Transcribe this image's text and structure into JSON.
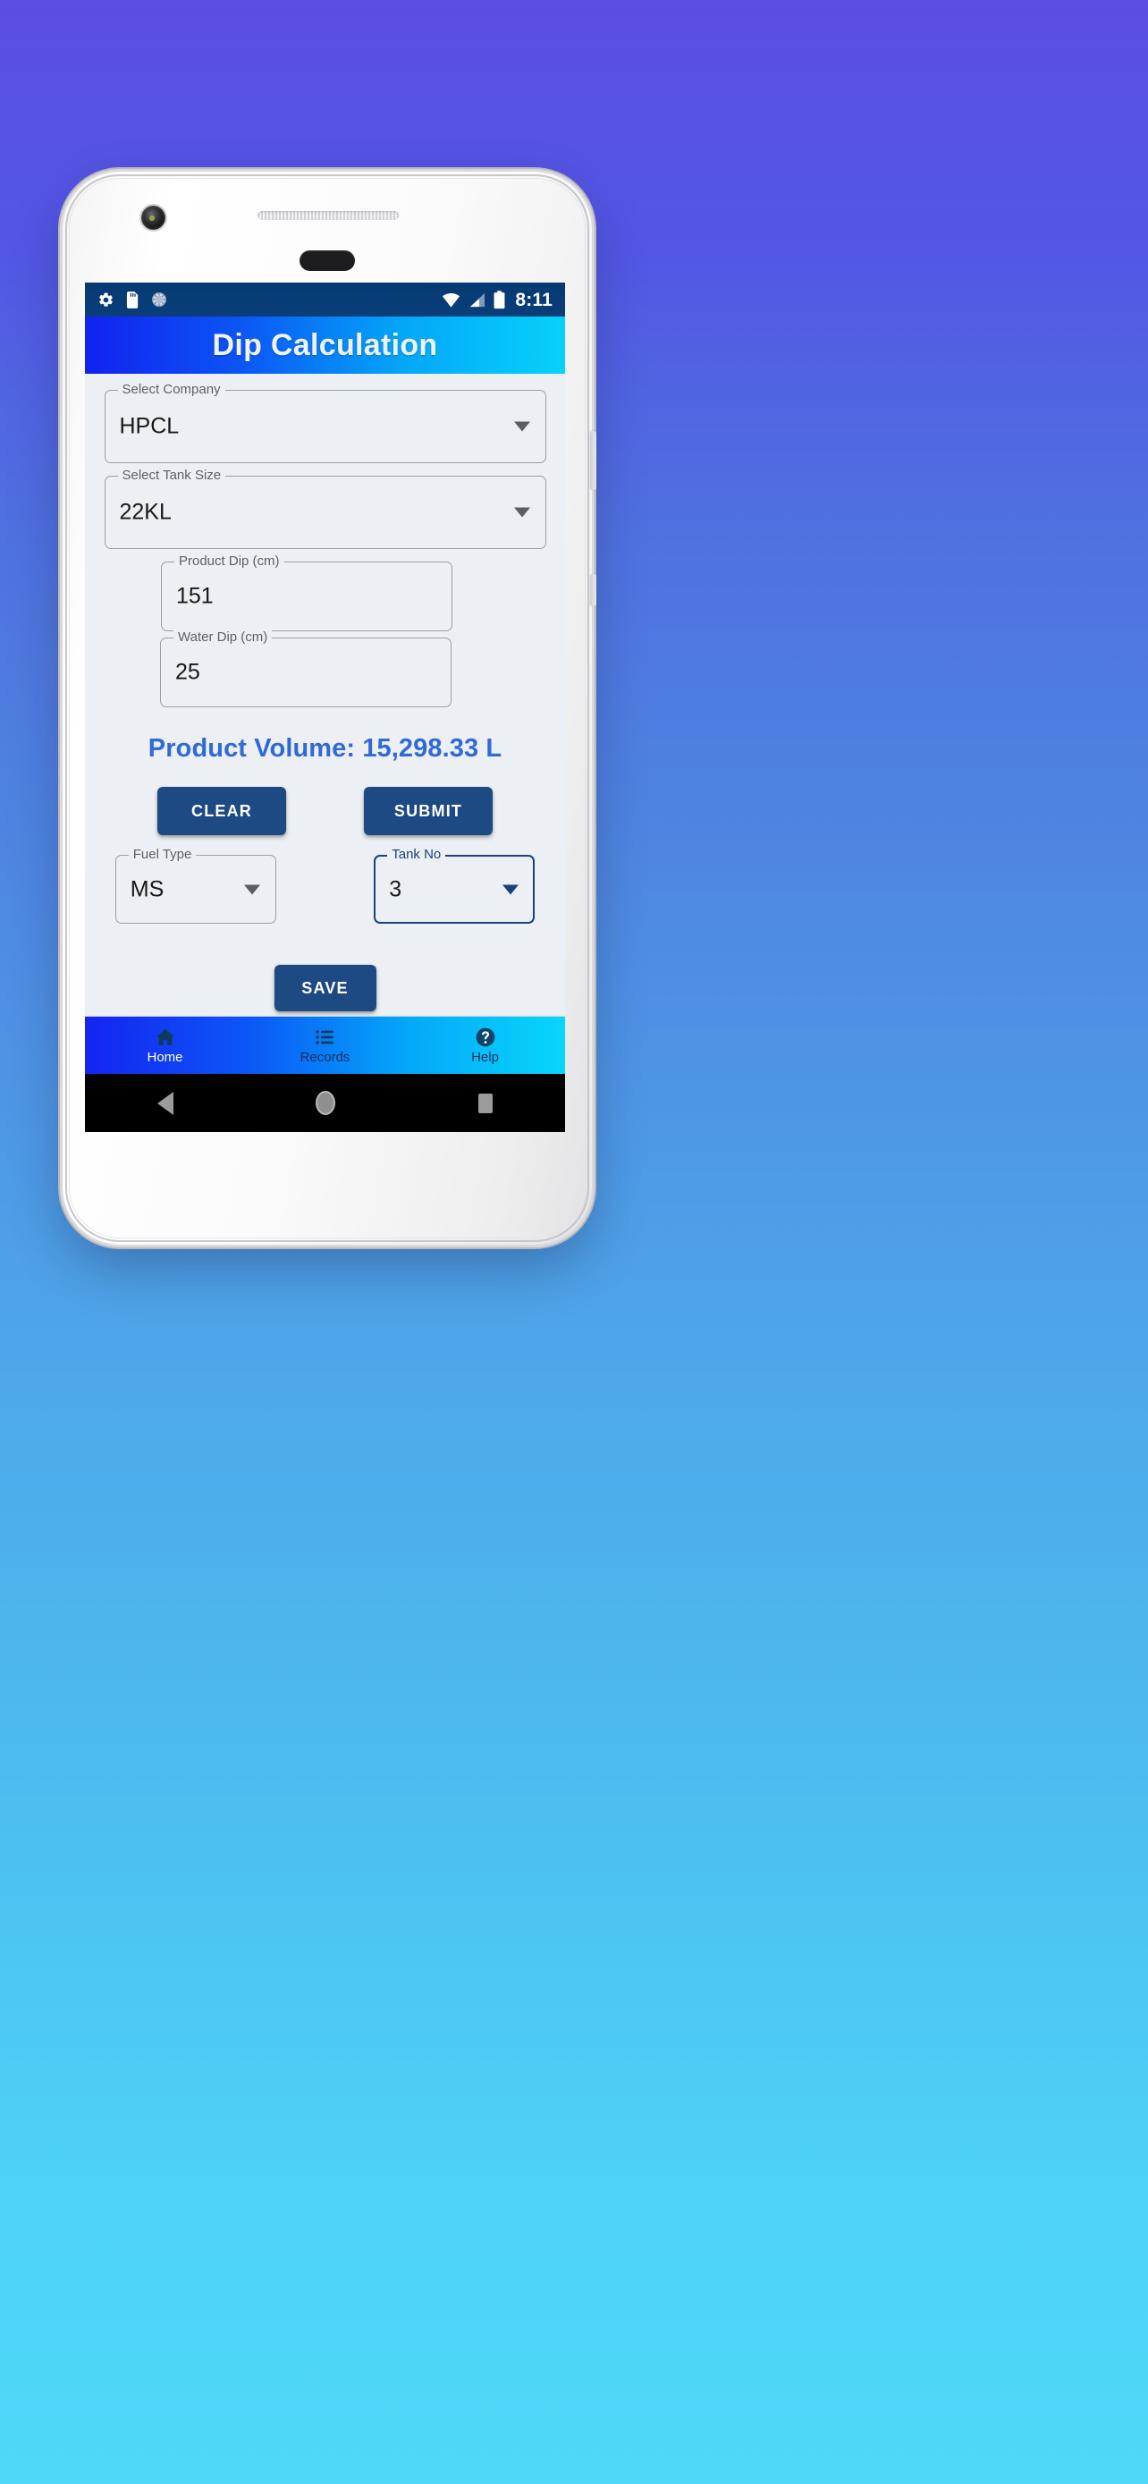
{
  "background": {
    "gradient_top": "#5b4ee2",
    "gradient_bottom": "#4fd8f8"
  },
  "device": {
    "name": "android-phone-mockup",
    "body_color": "#ffffff"
  },
  "statusbar": {
    "background": "#0a3d76",
    "time": "8:11",
    "left_icons": [
      "gear-icon",
      "sd-card-icon",
      "sync-circle-icon"
    ],
    "right_icons": [
      "wifi-icon",
      "signal-icon",
      "battery-icon"
    ]
  },
  "appbar": {
    "title": "Dip Calculation",
    "gradient_start": "#1122f0",
    "gradient_end": "#07d2fb"
  },
  "form": {
    "company": {
      "label": "Select Company",
      "value": "HPCL",
      "focused": false
    },
    "tank_size": {
      "label": "Select Tank Size",
      "value": "22KL",
      "focused": false
    },
    "product_dip": {
      "label": "Product Dip (cm)",
      "value": "151"
    },
    "water_dip": {
      "label": "Water Dip (cm)",
      "value": "25"
    },
    "fuel_type": {
      "label": "Fuel Type",
      "value": "MS",
      "focused": false
    },
    "tank_no": {
      "label": "Tank No",
      "value": "3",
      "focused": true
    }
  },
  "result": {
    "text": "Product Volume: 15,298.33 L",
    "color": "#2f6ad9"
  },
  "buttons": {
    "clear": "CLEAR",
    "submit": "SUBMIT",
    "save": "SAVE",
    "color": "#1e4a84"
  },
  "bottom_nav": {
    "items": [
      {
        "label": "Home",
        "icon": "home-icon",
        "active": true
      },
      {
        "label": "Records",
        "icon": "list-icon",
        "active": false
      },
      {
        "label": "Help",
        "icon": "help-circle-icon",
        "active": false
      }
    ]
  },
  "system_nav": {
    "buttons": [
      "back-triangle-icon",
      "home-circle-icon",
      "recents-square-icon"
    ]
  }
}
